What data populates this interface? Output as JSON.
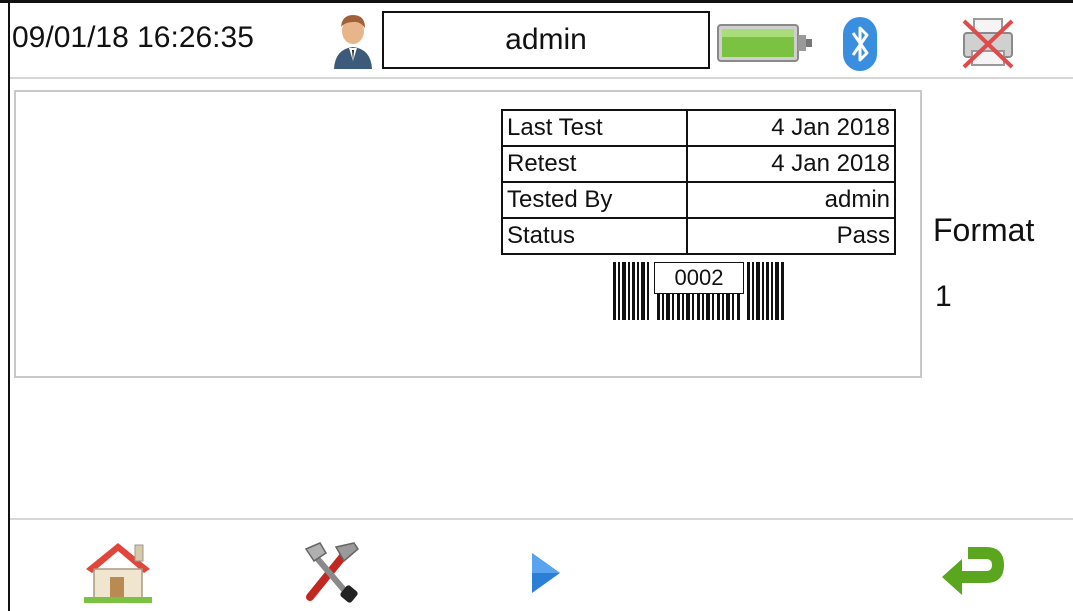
{
  "header": {
    "datetime": "09/01/18 16:26:35",
    "username": "admin",
    "icons": [
      "user-icon",
      "battery-icon",
      "bluetooth-icon",
      "printer-disabled-icon"
    ]
  },
  "label": {
    "rows": [
      {
        "key": "Last Test",
        "value": "4 Jan 2018"
      },
      {
        "key": "Retest",
        "value": "4 Jan 2018"
      },
      {
        "key": "Tested By",
        "value": "admin"
      },
      {
        "key": "Status",
        "value": "Pass"
      }
    ],
    "barcode_number": "0002"
  },
  "format": {
    "label": "Format",
    "value": "1"
  },
  "footer": {
    "icons": [
      "home-icon",
      "tools-icon",
      "next-arrow-icon",
      "back-return-icon"
    ]
  },
  "colors": {
    "battery": "#7cc242",
    "bluetooth": "#3a8ee0",
    "printer_cross": "#e04a4a",
    "home_roof": "#e0463c",
    "next_arrow": "#2b7fd6",
    "back_arrow": "#5aa61e"
  }
}
